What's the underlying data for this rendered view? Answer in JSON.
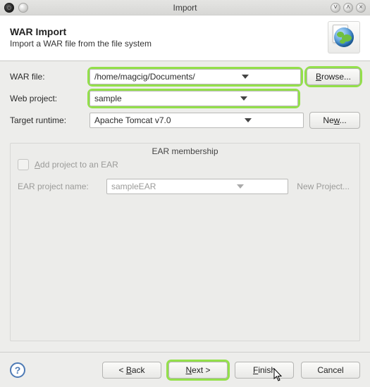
{
  "window": {
    "title": "Import"
  },
  "banner": {
    "heading": "WAR Import",
    "subheading": "Import a WAR file from the file system"
  },
  "form": {
    "war_file_label": "WAR file:",
    "web_project_label": "Web project:",
    "target_runtime_label": "Target runtime:",
    "war_file_value": "/home/magcig/Documents/sample.war",
    "web_project_value": "sample",
    "target_runtime_value": "Apache Tomcat v7.0",
    "browse_label": "Browse...",
    "new_label": "New..."
  },
  "group": {
    "title": "EAR membership",
    "add_label": "Add project to an EAR",
    "ear_label": "EAR project name:",
    "ear_value": "sampleEAR",
    "new_project_label": "New Project..."
  },
  "footer": {
    "back": "< Back",
    "next": "Next >",
    "finish": "Finish",
    "cancel": "Cancel"
  }
}
